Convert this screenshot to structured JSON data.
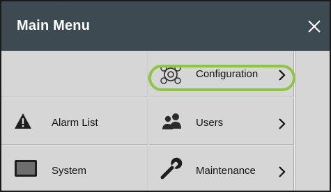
{
  "window": {
    "title": "Main Menu",
    "close_icon": "close-icon"
  },
  "menu": {
    "configuration": {
      "label": "Configuration",
      "icon": "gears-icon"
    },
    "alarm_list": {
      "label": "Alarm List",
      "icon": "warning-icon"
    },
    "users": {
      "label": "Users",
      "icon": "users-icon"
    },
    "system": {
      "label": "System",
      "icon": "monitor-icon"
    },
    "maintenance": {
      "label": "Maintenance",
      "icon": "wrench-icon"
    }
  },
  "colors": {
    "titlebar": "#3e4a52",
    "panel": "#d6d6d6",
    "highlight": "#8dc63f"
  }
}
